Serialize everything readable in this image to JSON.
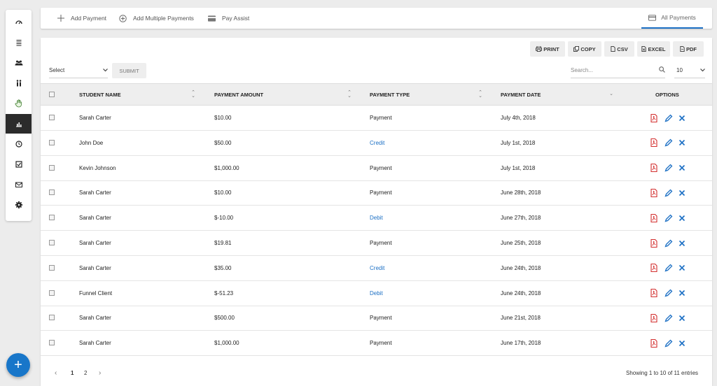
{
  "topbar": {
    "add_payment": "Add Payment",
    "add_multiple_payments": "Add Multiple Payments",
    "pay_assist": "Pay Assist",
    "all_payments_tab": "All Payments"
  },
  "sidebar": {
    "items": [
      "speedometer-icon",
      "list-icon",
      "group-icon",
      "people-icon",
      "hand-icon",
      "chart-icon",
      "clock-icon",
      "checkbox-icon",
      "mail-icon",
      "gear-icon"
    ],
    "active_index": 5
  },
  "exports": {
    "print": "PRINT",
    "copy": "COPY",
    "csv": "CSV",
    "excel": "EXCEL",
    "pdf": "PDF"
  },
  "filters": {
    "select_value": "Select",
    "submit_label": "SUBMIT",
    "search_placeholder": "Search...",
    "per_page": "10"
  },
  "table": {
    "columns": [
      "STUDENT NAME",
      "PAYMENT AMOUNT",
      "PAYMENT TYPE",
      "PAYMENT DATE",
      "OPTIONS"
    ],
    "rows": [
      {
        "name": "Sarah Carter",
        "amount": "$10.00",
        "type": "Payment",
        "date": "July 4th, 2018"
      },
      {
        "name": "John Doe",
        "amount": "$50.00",
        "type": "Credit",
        "date": "July 1st, 2018"
      },
      {
        "name": "Kevin Johnson",
        "amount": "$1,000.00",
        "type": "Payment",
        "date": "July 1st, 2018"
      },
      {
        "name": "Sarah Carter",
        "amount": "$10.00",
        "type": "Payment",
        "date": "June 28th, 2018"
      },
      {
        "name": "Sarah Carter",
        "amount": "$-10.00",
        "type": "Debit",
        "date": "June 27th, 2018"
      },
      {
        "name": "Sarah Carter",
        "amount": "$19.81",
        "type": "Payment",
        "date": "June 25th, 2018"
      },
      {
        "name": "Sarah Carter",
        "amount": "$35.00",
        "type": "Credit",
        "date": "June 24th, 2018"
      },
      {
        "name": "Funnel Client",
        "amount": "$-51.23",
        "type": "Debit",
        "date": "June 24th, 2018"
      },
      {
        "name": "Sarah Carter",
        "amount": "$500.00",
        "type": "Payment",
        "date": "June 21st, 2018"
      },
      {
        "name": "Sarah Carter",
        "amount": "$1,000.00",
        "type": "Payment",
        "date": "June 17th, 2018"
      }
    ]
  },
  "pagination": {
    "pages": [
      "1",
      "2"
    ],
    "current": "1",
    "summary": "Showing 1 to 10 of 11 entries"
  },
  "colors": {
    "accent": "#1b6fc4",
    "fab": "#1876c9",
    "pdf_red": "#d32f2f",
    "sidebar_active": "#2b2b2b"
  }
}
